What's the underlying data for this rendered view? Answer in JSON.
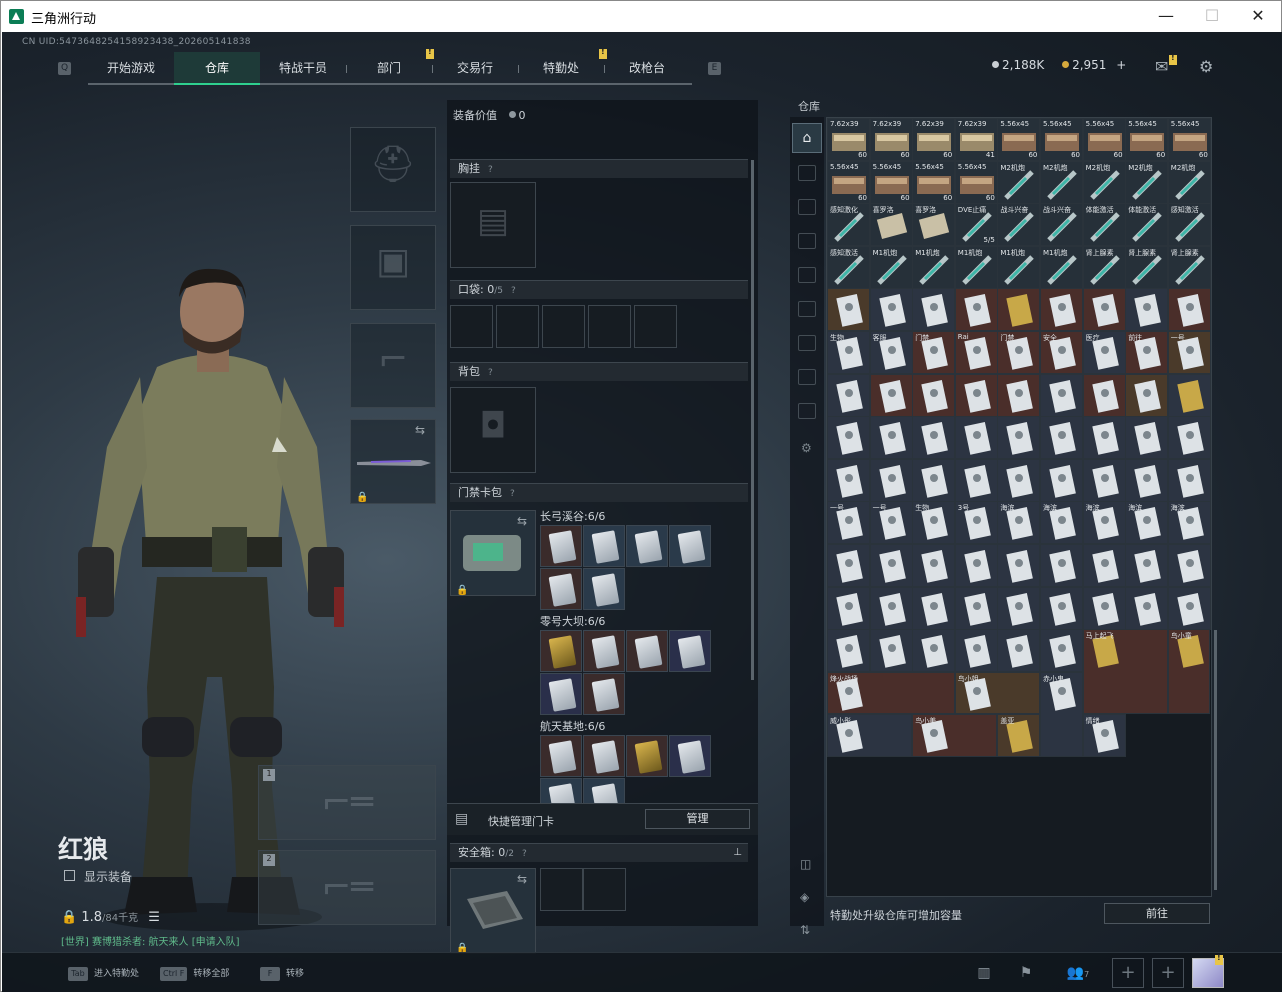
{
  "window": {
    "title": "三角洲行动"
  },
  "uid": "CN UID:5473648254158923438_202605141838",
  "nav": {
    "tabs": [
      "开始游戏",
      "仓库",
      "特战干员",
      "部门",
      "交易行",
      "特勤处",
      "改枪台"
    ],
    "active": 1
  },
  "currency": {
    "silver": "2,188K",
    "gold": "2,951",
    "plus": "+"
  },
  "character": {
    "name": "红狼",
    "show_equipment": "显示装备",
    "weight": "1.8",
    "weight_max": "/84千克",
    "chat": "[世界] 赛博猎杀者: 航天来人 [申请入队]"
  },
  "mid": {
    "equip_value_label": "装备价值",
    "equip_value": "0",
    "chest_label": "胸挂",
    "pocket_label": "口袋:",
    "pocket_count": "0",
    "pocket_max": "/5",
    "backpack_label": "背包",
    "keycard_label": "门禁卡包",
    "groups": [
      {
        "name": "长弓溪谷:",
        "count": "6/6"
      },
      {
        "name": "零号大坝:",
        "count": "6/6"
      },
      {
        "name": "航天基地:",
        "count": "6/6"
      }
    ],
    "quick_manage": "快捷管理门卡",
    "manage_button": "管理",
    "safebox_label": "安全箱:",
    "safebox_count": "0",
    "safebox_max": "/2"
  },
  "stash": {
    "title": "仓库",
    "footer_text": "特勤处升级仓库可增加容量",
    "goto_button": "前往",
    "row1_labels": [
      "7.62x39",
      "7.62x39",
      "7.62x39",
      "7.62x39",
      "5.56x45",
      "5.56x45",
      "5.56x45",
      "5.56x45",
      "5.56x45"
    ],
    "row1_counts": [
      "60",
      "60",
      "60",
      "41",
      "60",
      "60",
      "60",
      "60",
      "60"
    ],
    "row2_labels": [
      "5.56x45",
      "5.56x45",
      "5.56x45",
      "5.56x45",
      "M2机炮",
      "M2机炮",
      "M2机炮",
      "M2机炮",
      "M2机炮"
    ],
    "row3_labels": [
      "感知激化",
      "喜罗洛",
      "喜罗洛",
      "DVE止痛",
      "战斗兴奋",
      "战斗兴奋",
      "体能激活",
      "体能激活",
      "感知激活"
    ],
    "row4_labels": [
      "感知激活",
      "M1机炮",
      "M1机炮",
      "M1机炮",
      "M1机炮",
      "M1机炮",
      "肾上腺素",
      "肾上腺素",
      "肾上腺素"
    ],
    "row7_labels": [
      "生物",
      "客服",
      "门禁",
      "Rai",
      "门禁",
      "安全",
      "医疗",
      "前往",
      "一号"
    ],
    "rows_labels": [
      "一号",
      "一号",
      "生物",
      "3号",
      "海滨",
      "海滨",
      "海滨",
      "海滨",
      "海滨"
    ],
    "stack_count": "5/5",
    "bottom_labels": [
      "烽火战场",
      "鸟小姐",
      "赤小鬼",
      "马上起飞",
      "鸟小童",
      "威小彤",
      "鸟小美",
      "盖亚",
      "情绪"
    ]
  },
  "bottom": {
    "hints": [
      {
        "key": "Tab",
        "text": "进入特勤处"
      },
      {
        "key": "Ctrl F",
        "text": "转移全部"
      },
      {
        "key": "F",
        "text": "转移"
      }
    ],
    "squad_count": "7"
  }
}
